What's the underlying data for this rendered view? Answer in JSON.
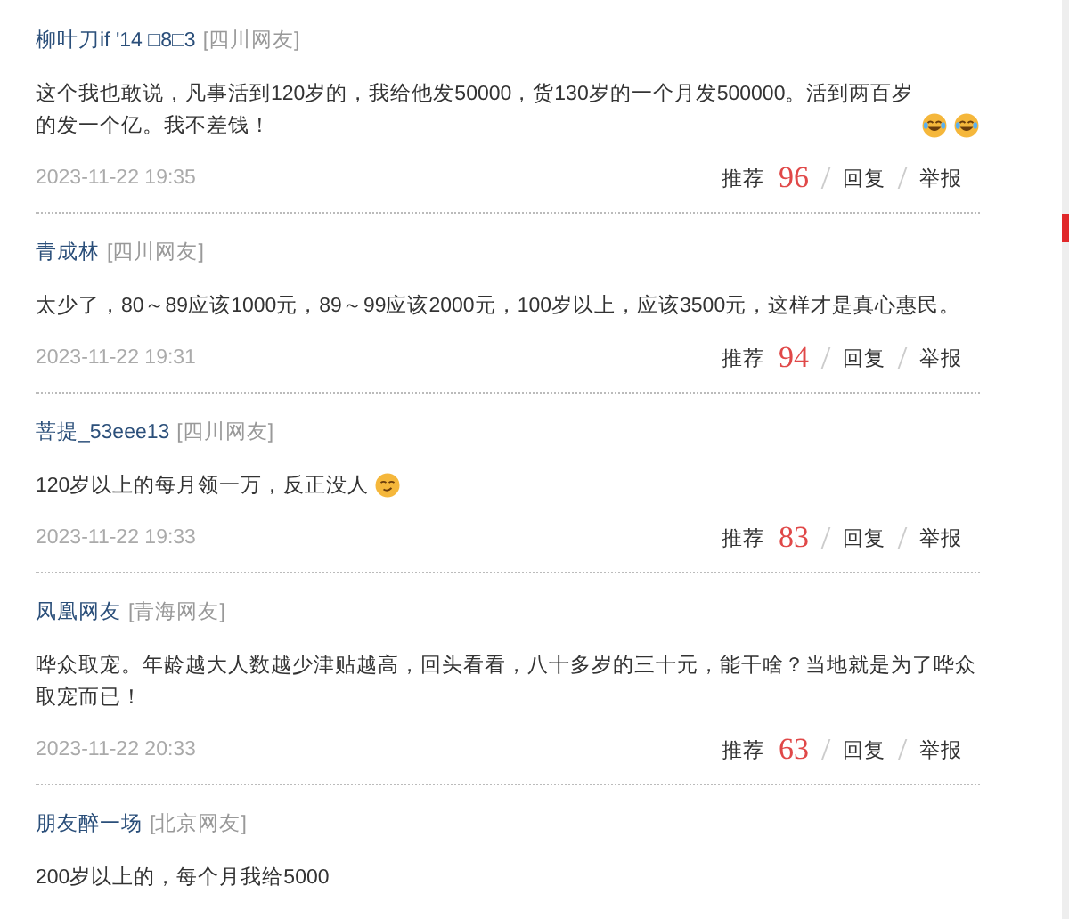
{
  "comments": [
    {
      "user": "柳叶刀if '14 □8□3",
      "location": "[四川网友]",
      "text": "这个我也敢说，凡事活到120岁的，我给他发50000，货130岁的一个月发500000。活到两百岁的发一个亿。我不差钱！",
      "emojis": [
        {
          "kind": "laugh-cry"
        },
        {
          "kind": "laugh-cry"
        }
      ],
      "time": "2023-11-22 19:35",
      "recommend": "推荐",
      "likes": "96",
      "reply": "回复",
      "report": "举报"
    },
    {
      "user": "青成林",
      "location": "[四川网友]",
      "text": "太少了，80～89应该1000元，89～99应该2000元，100岁以上，应该3500元，这样才是真心惠民。",
      "time": "2023-11-22 19:31",
      "recommend": "推荐",
      "likes": "94",
      "reply": "回复",
      "report": "举报"
    },
    {
      "user": "菩提_53eee13",
      "location": "[四川网友]",
      "text": "120岁以上的每月领一万，反正没人",
      "emojis": [
        {
          "kind": "smirk"
        }
      ],
      "time": "2023-11-22 19:33",
      "recommend": "推荐",
      "likes": "83",
      "reply": "回复",
      "report": "举报"
    },
    {
      "user": "凤凰网友",
      "location": "[青海网友]",
      "text": "哗众取宠。年龄越大人数越少津贴越高，回头看看，八十多岁的三十元，能干啥？当地就是为了哗众取宠而已！",
      "time": "2023-11-22 20:33",
      "recommend": "推荐",
      "likes": "63",
      "reply": "回复",
      "report": "举报"
    },
    {
      "user": "朋友醉一场",
      "location": "[北京网友]",
      "text": "200岁以上的，每个月我给5000"
    }
  ]
}
